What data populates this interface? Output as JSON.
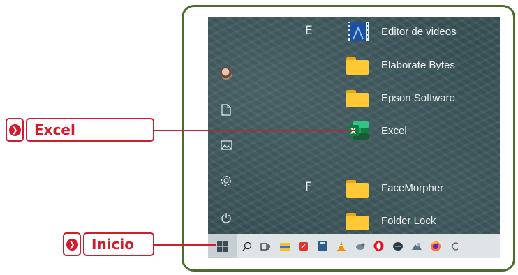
{
  "callouts": [
    {
      "id": "excel",
      "label": "Excel"
    },
    {
      "id": "inicio",
      "label": "Inicio"
    }
  ],
  "start_menu": {
    "groups": [
      {
        "letter": "E",
        "items": [
          {
            "label": "Editor de videos",
            "icon": "video-editor-icon"
          },
          {
            "label": "Elaborate Bytes",
            "icon": "folder-icon"
          },
          {
            "label": "Epson Software",
            "icon": "folder-icon"
          },
          {
            "label": "Excel",
            "icon": "excel-icon"
          }
        ]
      },
      {
        "letter": "F",
        "items": [
          {
            "label": "FaceMorpher",
            "icon": "folder-icon"
          },
          {
            "label": "Folder Lock",
            "icon": "folder-icon"
          }
        ]
      }
    ],
    "rail": [
      "user-avatar",
      "documents-icon",
      "pictures-icon",
      "settings-icon",
      "power-icon"
    ]
  },
  "taskbar": {
    "icons": [
      "start-icon",
      "search-icon",
      "task-view-icon",
      "file-explorer-icon",
      "app-red-icon",
      "calculator-icon",
      "vlc-icon",
      "app-bird-icon",
      "opera-icon",
      "app-dark-icon",
      "app-gray-icon",
      "firefox-icon"
    ]
  },
  "colors": {
    "accent": "#d11c2e",
    "frame": "#4d6b2c",
    "excel": "#1d6f42",
    "folder": "#ffc935"
  }
}
